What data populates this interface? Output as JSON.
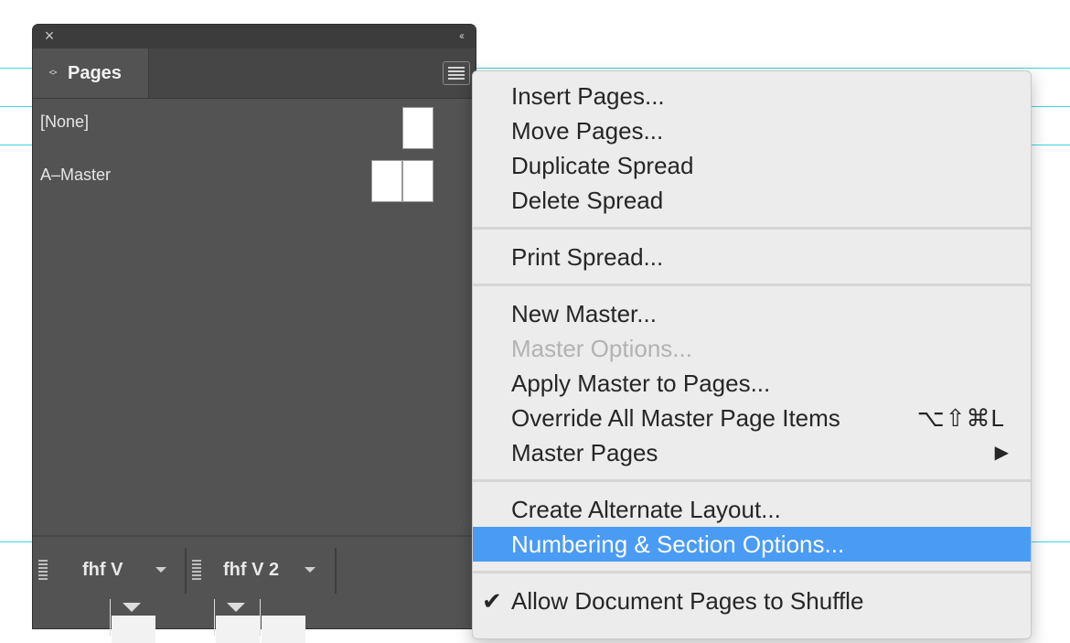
{
  "panel": {
    "tab_label": "Pages",
    "masters": [
      {
        "label": "[None]"
      },
      {
        "label": "A–Master"
      }
    ],
    "documents": [
      {
        "label": "fhf V"
      },
      {
        "label": "fhf V 2"
      }
    ]
  },
  "menu": {
    "items": [
      {
        "label": "Insert Pages..."
      },
      {
        "label": "Move Pages..."
      },
      {
        "label": "Duplicate Spread"
      },
      {
        "label": "Delete Spread"
      },
      {
        "label": "Print Spread..."
      },
      {
        "label": "New Master..."
      },
      {
        "label": "Master Options...",
        "disabled": true
      },
      {
        "label": "Apply Master to Pages..."
      },
      {
        "label": "Override All Master Page Items",
        "shortcut": "⌥⇧⌘L"
      },
      {
        "label": "Master Pages",
        "submenu": true
      },
      {
        "label": "Create Alternate Layout..."
      },
      {
        "label": "Numbering & Section Options...",
        "highlighted": true
      },
      {
        "label": "Allow Document Pages to Shuffle",
        "checked": true
      }
    ]
  },
  "icons": {
    "close": "close-icon",
    "collapse": "double-chevron-left-icon",
    "panel_menu": "hamburger-menu-icon",
    "check": "checkmark-icon",
    "submenu": "triangle-right-icon"
  },
  "colors": {
    "guide": "#3fd7e0",
    "panel_bg": "#535353",
    "highlight": "#4a9bf4"
  }
}
